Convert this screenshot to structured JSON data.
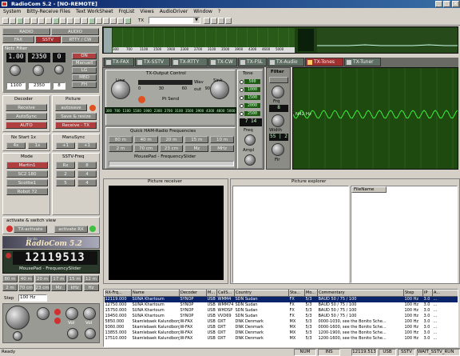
{
  "title": "RadioCom 5.2 - [NO-REMOTE]",
  "menu": [
    "System",
    "Bitty-Receive Files",
    "Text WorkSheet",
    "FrqList",
    "Views",
    "AudioDriver",
    "Window",
    "?"
  ],
  "toolbar": {
    "tx_label": "TX",
    "mode_select": ""
  },
  "mode_row1": [
    "RADIO",
    "AUDIO"
  ],
  "mode_row2": [
    "FAX",
    "SSTV",
    "RTTY / CW"
  ],
  "notch": {
    "title": "Notc Filter",
    "v1": "1.00",
    "v2": "2350",
    "v3": "0",
    "on": "ON",
    "btn2": "Manuell",
    "lg": "LG",
    "mbd": "MBD",
    "fh": "FH",
    "f1": "1100",
    "f2": "2350",
    "f3": "8"
  },
  "decoder": {
    "title": "Decoder",
    "receive": "Receive",
    "autosync": "AutoSync",
    "auto": "AUTO"
  },
  "picture": {
    "title": "Picture",
    "autosave": "autosave",
    "save": "Save & resize",
    "receive_tx": "Receive - TX"
  },
  "nx_start": {
    "title": "Nx Start 1x",
    "b1": "4x",
    "b2": "1x"
  },
  "mansync": {
    "title": "ManuSync",
    "b1": "+1",
    "b2": "+1"
  },
  "mode": {
    "title": "Mode",
    "items": [
      "Martin1",
      "SC2 180",
      "Scottie1",
      "Robot 72"
    ]
  },
  "sstv_freq": {
    "title": "SSTV-Freq",
    "items": [
      "Rx",
      "8",
      "2",
      "4",
      "5",
      "4"
    ]
  },
  "activate": {
    "title": "activate & switch view",
    "tx": "TX-activate",
    "rx": "activate RX"
  },
  "logo": {
    "sub": "Bonito",
    "name": "RadioCom 5.2"
  },
  "freq_display": {
    "value": "12119513",
    "label": "MousePad - FrequencySlider"
  },
  "bands": [
    [
      "80 m",
      "40 m",
      "20 m",
      "17 m",
      "15 m",
      "12 m"
    ],
    [
      "2 m",
      "70 cm",
      "23 cm",
      "Mz",
      "kHz",
      "Hz"
    ]
  ],
  "step": {
    "label": "Step",
    "value": "100 Hz"
  },
  "vol_labels": [
    "Vol",
    "Vol"
  ],
  "tabs": [
    "TX-FAX",
    "TX-SSTV",
    "TX-RTTY",
    "TX-CW",
    "TX-FSL",
    "TX-Audio",
    "TX-Tones",
    "TX-Tuner"
  ],
  "tx_output": {
    "title": "TX-Output Control",
    "line": "Line",
    "sink": "Sink",
    "wav": "Wav",
    "out": "out",
    "ptt": "Pt Send",
    "scale": [
      "0",
      "30",
      "60",
      "90"
    ]
  },
  "freq_scale": [
    "300",
    "700",
    "1100",
    "1500",
    "1900",
    "2300",
    "2700",
    "3100",
    "3500",
    "3900",
    "4300",
    "4600",
    "5000"
  ],
  "ham_panel": {
    "title": "Quick HAM-Radio Frequencies",
    "b1": [
      "80 m",
      "40 m",
      "20 m",
      "15 m",
      "10 m"
    ],
    "b2": [
      "2 m",
      "70 cm",
      "23 cm",
      "Mz",
      "MHz"
    ],
    "slider": "MousePad - FrequencySlider"
  },
  "tone": {
    "title": "Tone",
    "items": [
      "500",
      "1000",
      "1500",
      "2000",
      "2500"
    ],
    "freq_label": "Freq",
    "ampl_label": "Ampl",
    "value": "7 14"
  },
  "filter": {
    "title": "Filter",
    "f_label": "Frq",
    "v1": "8",
    "v2": "55 | 2",
    "w_label": "Width",
    "center_label": "Fir"
  },
  "wave_label": "N42 Hz",
  "picture_receiver": "Picture receiver",
  "picture_explorer": "Picture explorer",
  "filename_col": "FileName",
  "table": {
    "headers": [
      "RX-Frq...",
      "Name",
      "Decoder",
      "M...",
      "CallS...",
      "Country",
      "Sta...",
      "Mo...",
      "Commentary",
      "Step",
      "IP",
      "A..."
    ],
    "rows": [
      [
        "12119.000",
        "SUNA Khartoum",
        "SYNOP",
        "USB",
        "WMM4",
        "SDN Sudan",
        "FX",
        "5/3",
        "BAUD 50 / 75 / 100",
        "100 Hz",
        "3.0",
        "..."
      ],
      [
        "12750.000",
        "SUNA Khartoum",
        "SYNOP",
        "USB",
        "WMM74",
        "SDN Sudan",
        "FX",
        "5/3",
        "BAUD 50 / 75 / 100",
        "100 Hz",
        "3.0",
        "..."
      ],
      [
        "15750.000",
        "SUNA Khartoum",
        "SYNOP",
        "USB",
        "WHDSP",
        "SDN Sudan",
        "FX",
        "5/3",
        "BAUD 50 / 75 / 100",
        "100 Hz",
        "3.0",
        "..."
      ],
      [
        "19450.000",
        "SUNA Khartoum",
        "SYNOP",
        "USB",
        "VVD69",
        "SDN Sudan",
        "FX",
        "5/3",
        "BAUD 50 / 75 / 100",
        "100 Hz",
        "3.0",
        "..."
      ],
      [
        "5850.000",
        "Skamlebaek Kalundborg",
        "W-FAX",
        "USB",
        "OXT",
        "DNK Denmark",
        "MX",
        "5/3",
        "0000-1030, see the Bonito Sche...",
        "100 Hz",
        "3.0",
        "..."
      ],
      [
        "9360.000",
        "Skamlebaek Kalundborg",
        "W-FAX",
        "USB",
        "OXT",
        "DNK Denmark",
        "MX",
        "5/3",
        "0000-1600, see the Bonito Sche...",
        "100 Hz",
        "3.0",
        "..."
      ],
      [
        "13855.000",
        "Skamlebaek Kalundborg",
        "W-FAX",
        "USB",
        "OXT",
        "DNK Denmark",
        "MX",
        "5/3",
        "1200-1900, see the Bonito Sche...",
        "100 Hz",
        "3.0",
        "..."
      ],
      [
        "17510.000",
        "Skamlebaek Kalundborg",
        "W-FAX",
        "USB",
        "OXT",
        "DNK Denmark",
        "MX",
        "5/3",
        "1200-1600, see the Bonito Sche...",
        "100 Hz",
        "3.0",
        "..."
      ]
    ]
  },
  "status": {
    "ready": "Ready",
    "num": "NUM",
    "ins": "INS",
    "freq": "12119.513",
    "mode": "USB",
    "sstv": "SSTV",
    "wait": "WAIT_SSTV_RUN"
  },
  "colors": {
    "title_bar": "#0a246a",
    "green_panel": "#1e5a14",
    "wave": "#3cf03c",
    "freq_lcd_bg": "#1a1a1a"
  }
}
